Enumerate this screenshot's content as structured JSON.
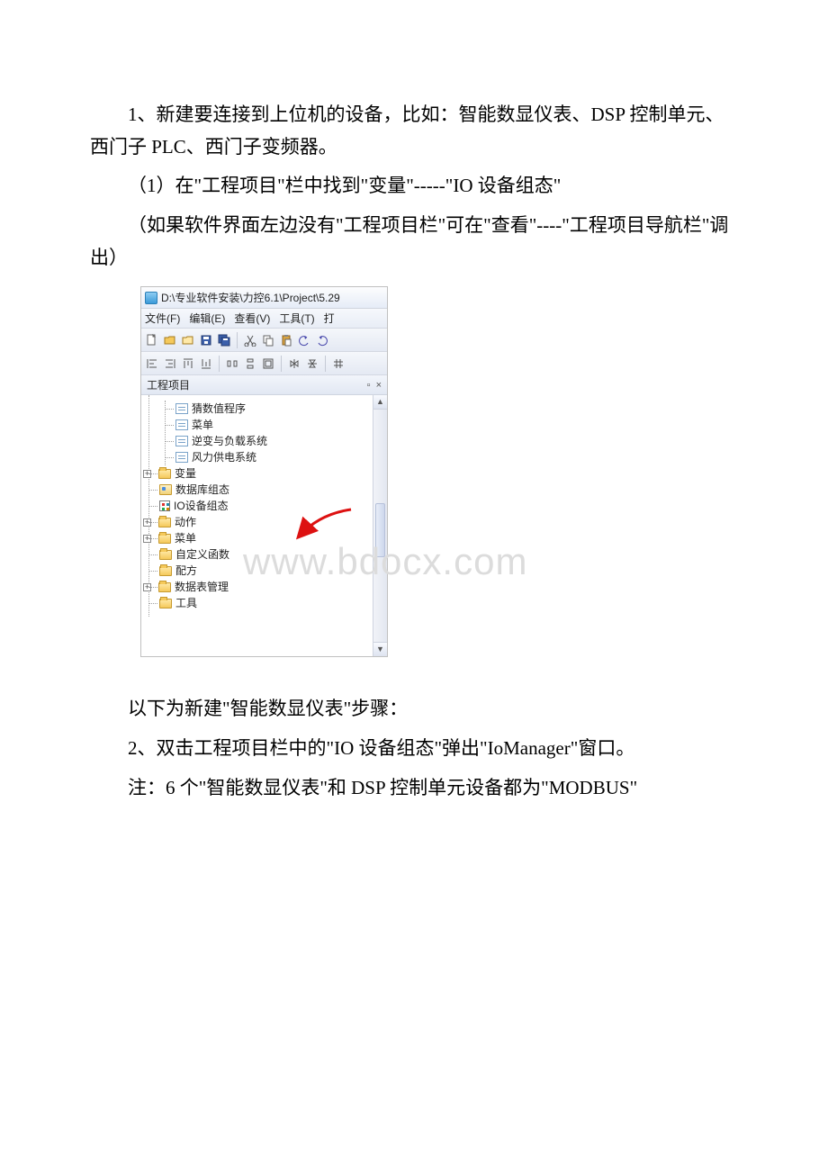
{
  "paragraphs": {
    "p1": "1、新建要连接到上位机的设备，比如：智能数显仪表、DSP 控制单元、西门子 PLC、西门子变频器。",
    "p2": "（1）在\"工程项目\"栏中找到\"变量\"-----\"IO 设备组态\"",
    "p3": "（如果软件界面左边没有\"工程项目栏\"可在\"查看\"----\"工程项目导航栏\"调出）",
    "p4": "以下为新建\"智能数显仪表\"步骤：",
    "p5": "2、双击工程项目栏中的\"IO 设备组态\"弹出\"IoManager\"窗口。",
    "p6": " 注：6 个\"智能数显仪表\"和 DSP 控制单元设备都为\"MODBUS\""
  },
  "watermark": "www.bdocx.com",
  "screenshot": {
    "title": "D:\\专业软件安装\\力控6.1\\Project\\5.29",
    "menu": {
      "file": "文件(F)",
      "edit": "编辑(E)",
      "view": "查看(V)",
      "tool": "工具(T)",
      "more": "打"
    },
    "panel_label": "工程项目",
    "pin": "▫",
    "close": "×",
    "tree": {
      "n1": "猜数值程序",
      "n2": "菜单",
      "n3": "逆变与负载系统",
      "n4": "风力供电系统",
      "n5": "变量",
      "n6": "数据库组态",
      "n7": "IO设备组态",
      "n8": "动作",
      "n9": "菜单",
      "n10": "自定义函数",
      "n11": "配方",
      "n12": "数据表管理",
      "n13": "工具"
    },
    "expand": {
      "plus": "+",
      "minus": "−"
    },
    "scroll": {
      "up": "▲",
      "down": "▼"
    }
  }
}
